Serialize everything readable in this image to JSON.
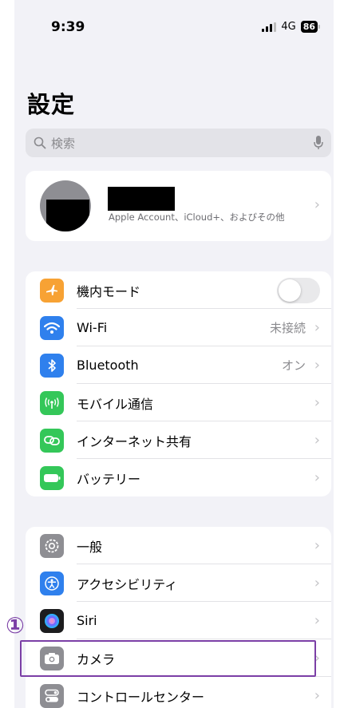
{
  "status_bar": {
    "time": "9:39",
    "network": "4G",
    "battery": "86"
  },
  "title": "設定",
  "search": {
    "placeholder": "検索"
  },
  "account": {
    "subtitle": "Apple Account、iCloud+、およびその他"
  },
  "group1": [
    {
      "label": "機内モード",
      "value": "",
      "icon": "airplane-icon",
      "color": "#f7a234",
      "toggle": true
    },
    {
      "label": "Wi-Fi",
      "value": "未接続",
      "icon": "wifi-icon",
      "color": "#2f80ed"
    },
    {
      "label": "Bluetooth",
      "value": "オン",
      "icon": "bluetooth-icon",
      "color": "#2f80ed"
    },
    {
      "label": "モバイル通信",
      "value": "",
      "icon": "antenna-icon",
      "color": "#34c759"
    },
    {
      "label": "インターネット共有",
      "value": "",
      "icon": "link-icon",
      "color": "#34c759"
    },
    {
      "label": "バッテリー",
      "value": "",
      "icon": "battery-icon",
      "color": "#34c759"
    }
  ],
  "group2": [
    {
      "label": "一般",
      "icon": "gear-icon",
      "color": "#8e8e93"
    },
    {
      "label": "アクセシビリティ",
      "icon": "accessibility-icon",
      "color": "#2f80ed"
    },
    {
      "label": "Siri",
      "icon": "siri-icon",
      "color": "#1c1c1e"
    },
    {
      "label": "カメラ",
      "icon": "camera-icon",
      "color": "#8e8e93"
    },
    {
      "label": "コントロールセンター",
      "icon": "switches-icon",
      "color": "#8e8e93"
    }
  ],
  "annotation": {
    "step": "①"
  }
}
